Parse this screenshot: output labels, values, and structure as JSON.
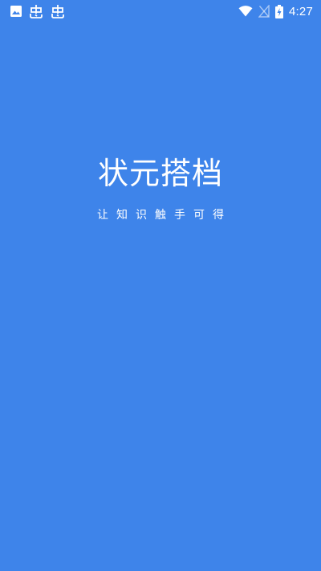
{
  "status_bar": {
    "time": "4:27",
    "left_icons": [
      "image-notification-icon",
      "bug-notification-icon",
      "bug-notification-icon"
    ],
    "right_icons": [
      "wifi-icon",
      "no-signal-icon",
      "battery-charging-icon"
    ]
  },
  "splash": {
    "title": "状元搭档",
    "slogan": "让知识触手可得"
  },
  "colors": {
    "background": "#3E84EA",
    "foreground": "#FFFFFF"
  }
}
